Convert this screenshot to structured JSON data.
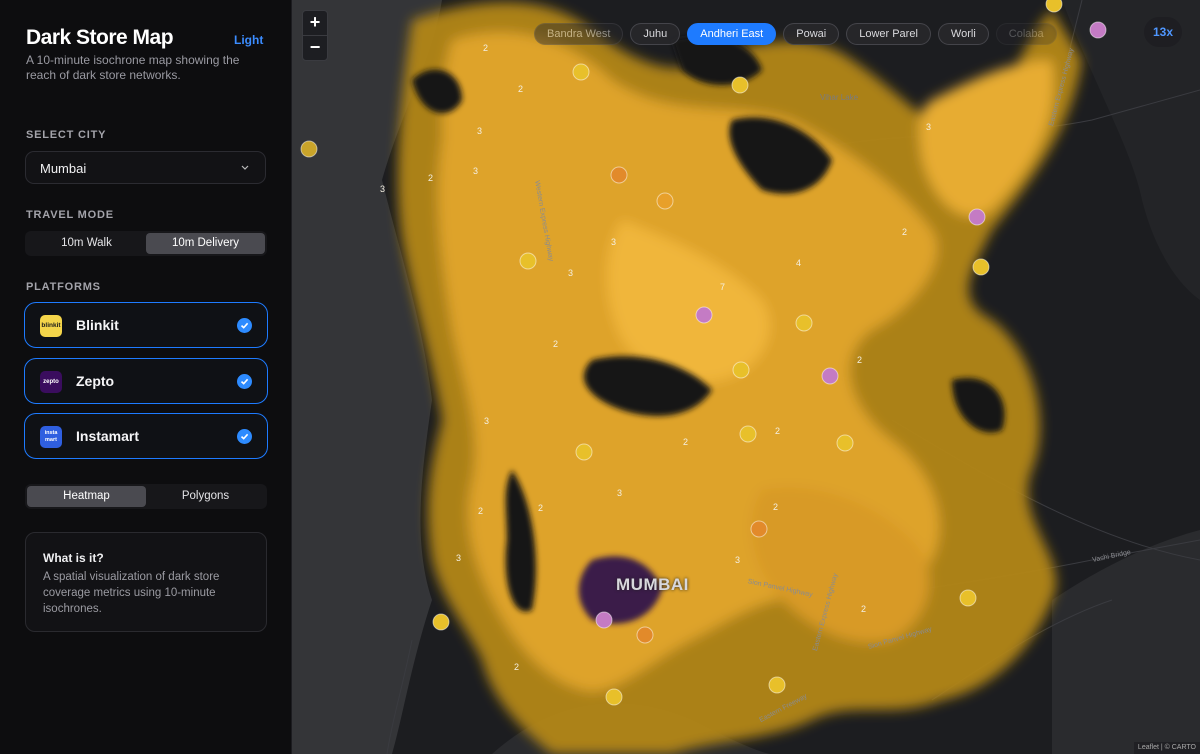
{
  "sidebar": {
    "title": "Dark Store Map",
    "theme_toggle": "Light",
    "subtitle": "A 10-minute isochrone map showing the reach of dark store networks.",
    "select_city_label": "SELECT CITY",
    "city_value": "Mumbai",
    "travel_mode_label": "TRAVEL MODE",
    "travel_modes": [
      "10m Walk",
      "10m Delivery"
    ],
    "travel_mode_selected": "10m Delivery",
    "platforms_label": "PLATFORMS",
    "platforms": [
      {
        "name": "Blinkit",
        "logo": "blinkit",
        "checked": true
      },
      {
        "name": "Zepto",
        "logo": "zepto",
        "checked": true
      },
      {
        "name": "Instamart",
        "logo": "instamart",
        "checked": true
      }
    ],
    "view_modes": [
      "Heatmap",
      "Polygons"
    ],
    "view_mode_selected": "Heatmap",
    "info": {
      "title": "What is it?",
      "body": "A spatial visualization of dark store coverage metrics using 10-minute isochrones."
    }
  },
  "map": {
    "zoom_in": "+",
    "zoom_out": "−",
    "zoom_level": "13x",
    "areas": [
      "Bandra West",
      "Juhu",
      "Andheri East",
      "Powai",
      "Lower Parel",
      "Worli",
      "Colaba"
    ],
    "area_selected": "Andheri East",
    "city_label": "MUMBAI",
    "place_labels": [
      "Vihar Lake"
    ],
    "road_labels": [
      "Western Express Highway",
      "Sion Panvel Highway",
      "Eastern Freeway",
      "Eastern Express Highway",
      "Vashi Bridge"
    ],
    "attribution": "Leaflet | © CARTO",
    "coverage_counts": [
      "2",
      "2",
      "3",
      "3",
      "2",
      "3",
      "3",
      "3",
      "4",
      "7",
      "2",
      "2",
      "3",
      "2",
      "2",
      "2",
      "3",
      "2",
      "2",
      "3",
      "3",
      "2",
      "2",
      "2",
      "3"
    ],
    "colors": {
      "heat_low": "#b38718",
      "heat_mid": "#e0a42c",
      "heat_high": "#f0b63a",
      "store_yellow": "#e8c02a",
      "store_orange": "#e28a2a",
      "store_purple": "#c47bc4",
      "accent": "#1e7bff"
    }
  }
}
